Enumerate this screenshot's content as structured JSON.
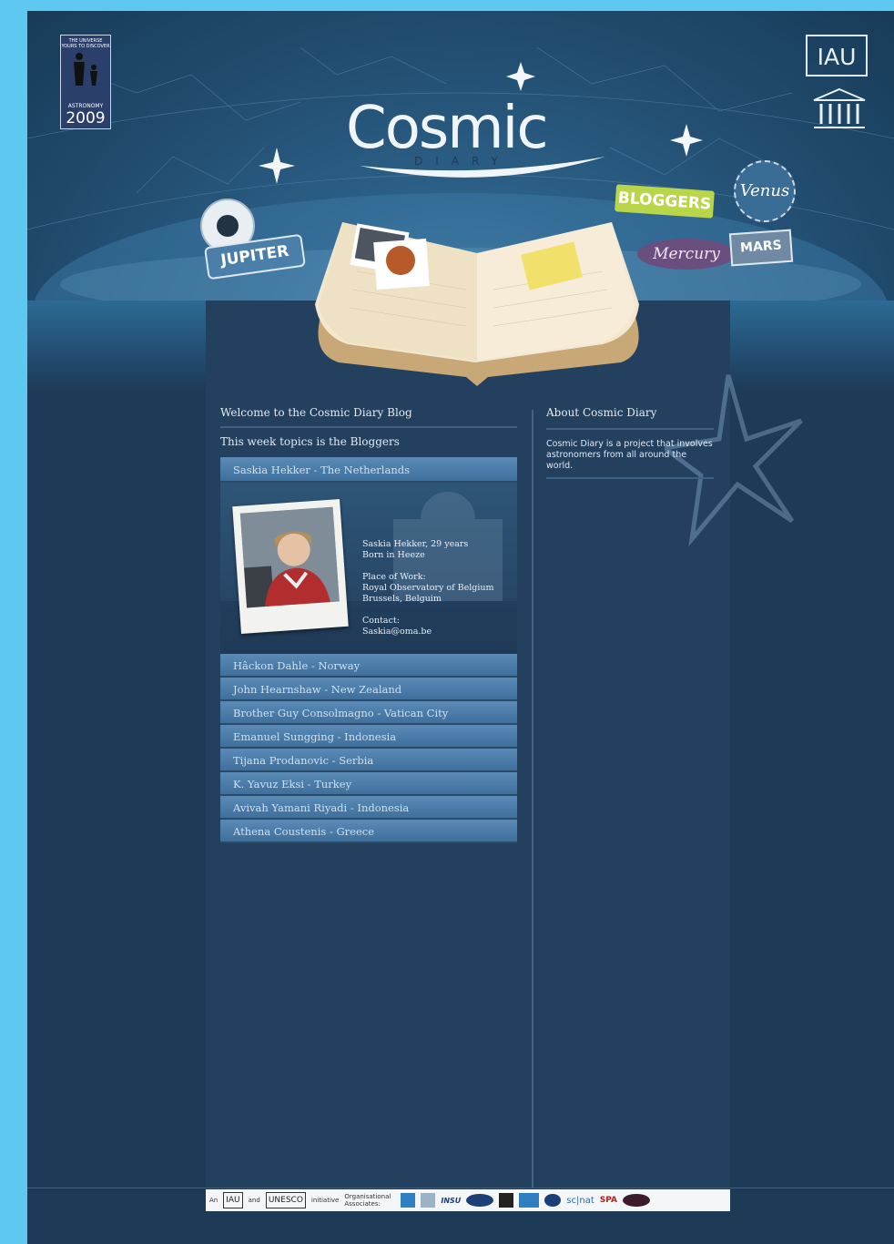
{
  "header": {
    "logo_title": "Cosmic",
    "logo_subtitle": "DIARY",
    "iya_logo": {
      "top": "THE UNIVERSE YOURS TO DISCOVER",
      "middle": "ASTRONOMY",
      "year": "2009"
    },
    "iau_logo": "IAU",
    "unesco_logo": "UNESCO",
    "stickers": {
      "bloggers": "BLOGGERS",
      "jupiter": "JUPITER",
      "venus": "Venus",
      "mercury": "Mercury",
      "mars": "MARS"
    }
  },
  "main": {
    "welcome_heading": "Welcome to the Cosmic Diary Blog",
    "topics_heading": "This week topics is the Bloggers",
    "active_blogger": {
      "label": "Saskia Hekker - The Netherlands",
      "line1": "Saskia Hekker, 29 years",
      "line2": "Born in Heeze",
      "work_label": "Place of Work:",
      "work_place": "Royal Observatory of Belgium",
      "work_city": "Brussels, Belguim",
      "contact_label": "Contact:",
      "contact_value": "Saskia@oma.be"
    },
    "bloggers": [
      "Hâckon Dahle - Norway",
      "John Hearnshaw - New Zealand",
      "Brother Guy Consolmagno - Vatican City",
      "Emanuel Sungging - Indonesia",
      "Tijana Prodanovic - Serbia",
      "K. Yavuz Eksi - Turkey",
      "Avivah Yamani Riyadi - Indonesia",
      "Athena Coustenis - Greece"
    ]
  },
  "sidebar": {
    "about_heading": "About Cosmic Diary",
    "about_text": "Cosmic Diary is a project that involves astronomers from all around the world."
  },
  "footer": {
    "an": "An",
    "iau": "IAU",
    "and": "and",
    "unesco": "UNESCO",
    "initiative": "initiative",
    "associates": "Organisational Associates:",
    "insu": "INSU",
    "scnat": "sc|nat",
    "spa": "SPA"
  }
}
